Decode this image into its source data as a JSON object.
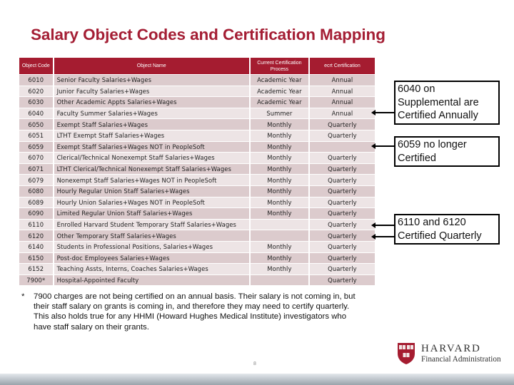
{
  "slide": {
    "title": "Salary Object Codes and Certification Mapping",
    "page_number": "8"
  },
  "table": {
    "headers": {
      "code": "Object Code",
      "name": "Object Name",
      "process": "Current Certification Process",
      "cert": "ecrt Certification"
    },
    "rows": [
      {
        "code": "6010",
        "name": "Senior Faculty Salaries+Wages",
        "process": "Academic Year",
        "cert": "Annual"
      },
      {
        "code": "6020",
        "name": "Junior Faculty Salaries+Wages",
        "process": "Academic Year",
        "cert": "Annual"
      },
      {
        "code": "6030",
        "name": "Other Academic Appts Salaries+Wages",
        "process": "Academic Year",
        "cert": "Annual"
      },
      {
        "code": "6040",
        "name": "Faculty Summer Salaries+Wages",
        "process": "Summer",
        "cert": "Annual"
      },
      {
        "code": "6050",
        "name": "Exempt Staff Salaries+Wages",
        "process": "Monthly",
        "cert": "Quarterly"
      },
      {
        "code": "6051",
        "name": "LTHT Exempt Staff Salaries+Wages",
        "process": "Monthly",
        "cert": "Quarterly"
      },
      {
        "code": "6059",
        "name": "Exempt Staff Salaries+Wages NOT in PeopleSoft",
        "process": "Monthly",
        "cert": ""
      },
      {
        "code": "6070",
        "name": "Clerical/Technical Nonexempt Staff Salaries+Wages",
        "process": "Monthly",
        "cert": "Quarterly"
      },
      {
        "code": "6071",
        "name": "LTHT Clerical/Technical Nonexempt Staff Salaries+Wages",
        "process": "Monthly",
        "cert": "Quarterly"
      },
      {
        "code": "6079",
        "name": "Nonexempt Staff Salaries+Wages NOT in PeopleSoft",
        "process": "Monthly",
        "cert": "Quarterly"
      },
      {
        "code": "6080",
        "name": "Hourly Regular Union Staff Salaries+Wages",
        "process": "Monthly",
        "cert": "Quarterly"
      },
      {
        "code": "6089",
        "name": "Hourly Union Salaries+Wages NOT in PeopleSoft",
        "process": "Monthly",
        "cert": "Quarterly"
      },
      {
        "code": "6090",
        "name": "Limited Regular Union Staff Salaries+Wages",
        "process": "Monthly",
        "cert": "Quarterly"
      },
      {
        "code": "6110",
        "name": "Enrolled Harvard Student Temporary Staff Salaries+Wages",
        "process": "",
        "cert": "Quarterly"
      },
      {
        "code": "6120",
        "name": "Other Temporary Staff Salaries+Wages",
        "process": "",
        "cert": "Quarterly"
      },
      {
        "code": "6140",
        "name": "Students in Professional Positions, Salaries+Wages",
        "process": "Monthly",
        "cert": "Quarterly"
      },
      {
        "code": "6150",
        "name": "Post-doc Employees Salaries+Wages",
        "process": "Monthly",
        "cert": "Quarterly"
      },
      {
        "code": "6152",
        "name": "Teaching Assts, Interns, Coaches Salaries+Wages",
        "process": "Monthly",
        "cert": "Quarterly"
      },
      {
        "code": "7900*",
        "name": "Hospital-Appointed Faculty",
        "process": "",
        "cert": "Quarterly"
      }
    ]
  },
  "callouts": [
    {
      "text": "6040 on Supplemental are Certified Annually",
      "points_to": [
        "6040"
      ]
    },
    {
      "text": "6059 no longer Certified",
      "points_to": [
        "6059"
      ]
    },
    {
      "text": "6110 and 6120 Certified Quarterly",
      "points_to": [
        "6110",
        "6120"
      ]
    }
  ],
  "footnote": {
    "marker": "*",
    "text": "7900 charges are not being certified on an annual basis.  Their salary is not coming in, but their staff salary on grants is coming in, and therefore they may need to certify quarterly.  This also holds true for any HHMI (Howard Hughes Medical Institute) investigators who have staff salary on their  grants."
  },
  "logo": {
    "name": "HARVARD",
    "subtitle": "Financial Administration",
    "shield_text": [
      "VE",
      "RI",
      "TAS"
    ]
  },
  "colors": {
    "brand_crimson": "#a51c30",
    "row_dark": "#dccbcd",
    "row_light": "#ede4e5"
  }
}
